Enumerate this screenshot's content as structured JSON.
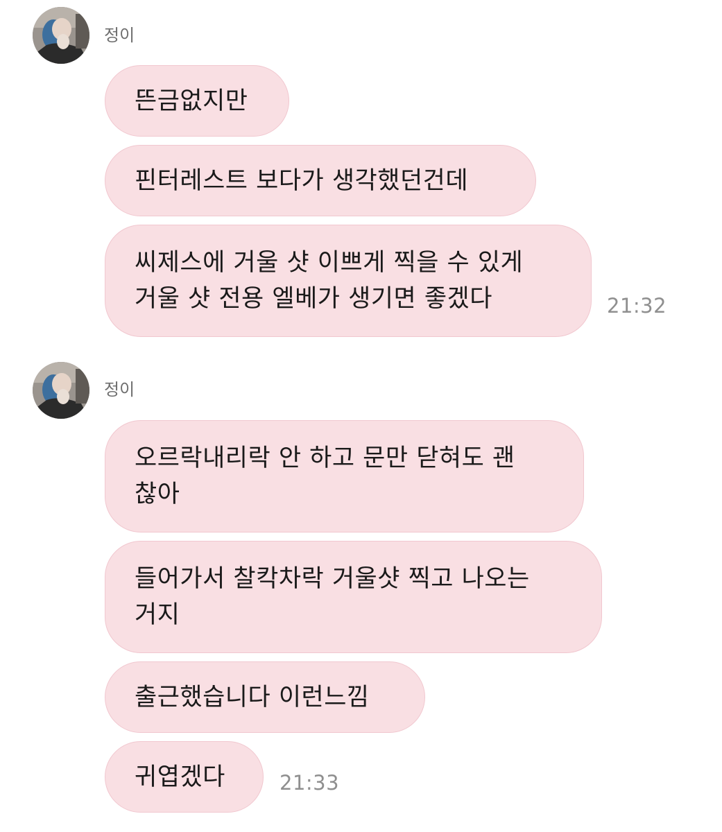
{
  "groups": [
    {
      "sender": "정이",
      "messages": [
        "뜬금없지만",
        "핀터레스트 보다가 생각했던건데",
        "씨제스에 거울 샷 이쁘게 찍을 수 있게\n거울 샷 전용 엘베가 생기면 좋겠다"
      ],
      "time": "21:32"
    },
    {
      "sender": "정이",
      "messages": [
        "오르락내리락 안 하고 문만 닫혀도 괜\n찮아",
        "들어가서 찰칵차락 거울샷 찍고 나오는\n거지",
        "출근했습니다 이런느낌",
        "귀엽겠다"
      ],
      "time": "21:33"
    }
  ]
}
